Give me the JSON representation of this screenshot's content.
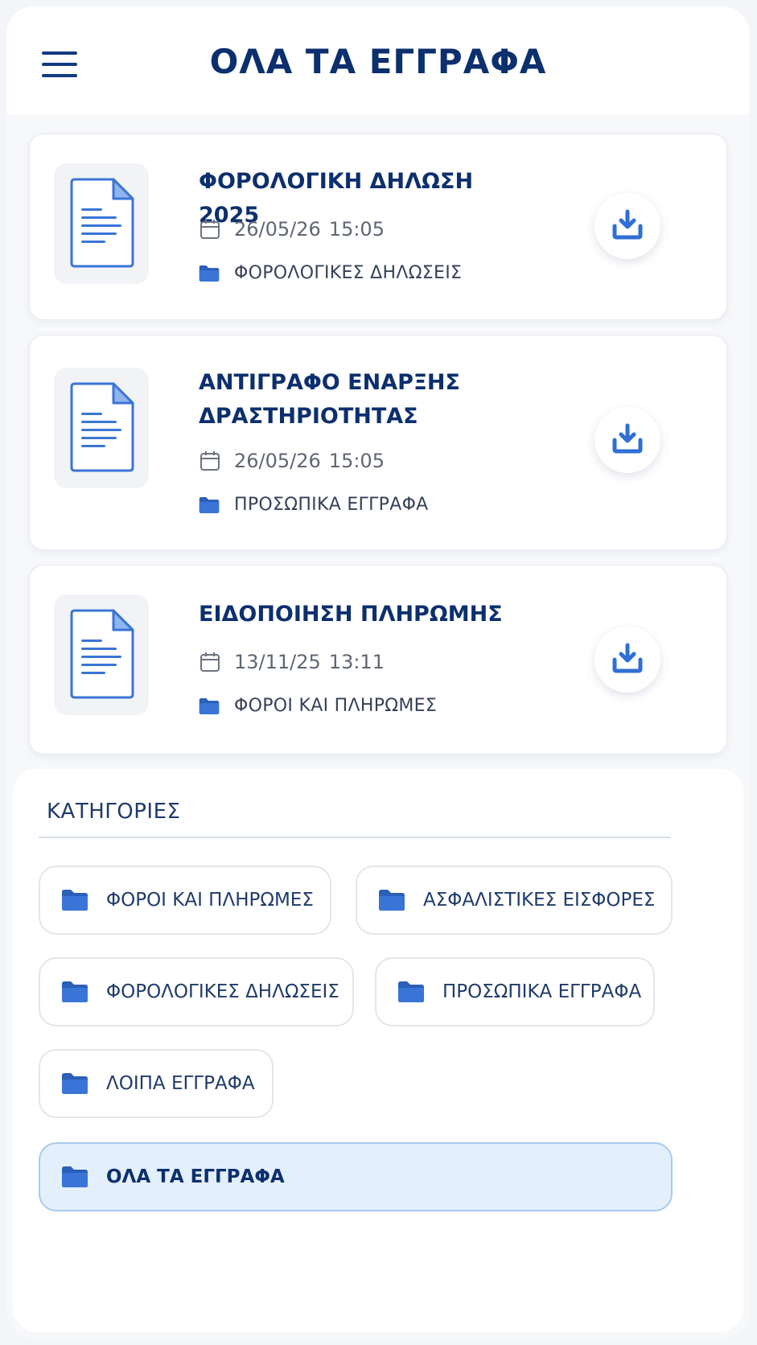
{
  "header": {
    "title": "ΟΛΑ ΤΑ ΕΓΓΡΑΦΑ"
  },
  "documents": [
    {
      "title": "ΦΟΡΟΛΟΓΙΚΗ ΔΗΛΩΣΗ 2025",
      "date": "26/05/26",
      "time": "15:05",
      "category": "ΦΟΡΟΛΟΓΙΚΕΣ ΔΗΛΩΣΕΙΣ"
    },
    {
      "title": "ΑΝΤΙΓΡΑΦΟ ΕΝΑΡΞΗΣ ΔΡΑΣΤΗΡΙΟΤΗΤΑΣ",
      "date": "26/05/26",
      "time": "15:05",
      "category": "ΠΡΟΣΩΠΙΚΑ ΕΓΓΡΑΦΑ"
    },
    {
      "title": "ΕΙΔΟΠΟΙΗΣΗ ΠΛΗΡΩΜΗΣ",
      "date": "13/11/25",
      "time": "13:11",
      "category": "ΦΟΡΟΙ ΚΑΙ ΠΛΗΡΩΜΕΣ"
    }
  ],
  "categories": {
    "heading": "ΚΑΤΗΓΟΡΙΕΣ",
    "items": [
      {
        "label": "ΦΟΡΟΙ ΚΑΙ ΠΛΗΡΩΜΕΣ"
      },
      {
        "label": "ΑΣΦΑΛΙΣΤΙΚΕΣ ΕΙΣΦΟΡΕΣ"
      },
      {
        "label": "ΦΟΡΟΛΟΓΙΚΕΣ ΔΗΛΩΣΕΙΣ"
      },
      {
        "label": "ΠΡΟΣΩΠΙΚΑ ΕΓΓΡΑΦΑ"
      },
      {
        "label": "ΛΟΙΠΑ ΕΓΓΡΑΦΑ"
      },
      {
        "label": "ΟΛΑ ΤΑ ΕΓΓΡΑΦΑ",
        "active": true
      }
    ]
  },
  "icons": {
    "menu": "hamburger-menu-icon",
    "document": "document-file-icon",
    "calendar": "calendar-icon",
    "folder": "folder-icon",
    "download": "download-icon"
  },
  "colors": {
    "primary": "#0c2f6e",
    "accent": "#2f6fd6",
    "active_chip": "#e3effa"
  }
}
